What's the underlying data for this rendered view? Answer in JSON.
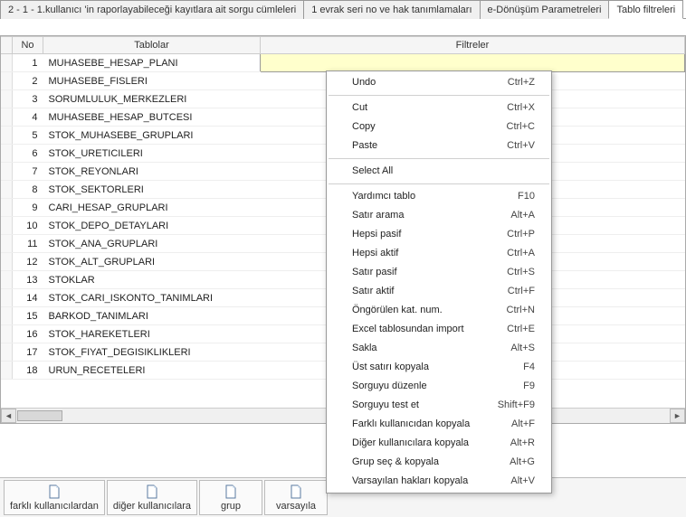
{
  "tabs": [
    {
      "label": "2 - 1 - 1.kullanıcı 'in raporlayabileceği kayıtlara ait sorgu cümleleri",
      "active": false
    },
    {
      "label": "1 evrak seri no ve hak tanımlamaları",
      "active": false
    },
    {
      "label": "e-Dönüşüm Parametreleri",
      "active": false
    },
    {
      "label": "Tablo filtreleri",
      "active": true
    }
  ],
  "grid": {
    "headers": {
      "no": "No",
      "tablolar": "Tablolar",
      "filtreler": "Filtreler"
    },
    "rows": [
      {
        "no": "1",
        "name": "MUHASEBE_HESAP_PLANI",
        "selected": true
      },
      {
        "no": "2",
        "name": "MUHASEBE_FISLERI"
      },
      {
        "no": "3",
        "name": "SORUMLULUK_MERKEZLERI"
      },
      {
        "no": "4",
        "name": "MUHASEBE_HESAP_BUTCESI"
      },
      {
        "no": "5",
        "name": "STOK_MUHASEBE_GRUPLARI"
      },
      {
        "no": "6",
        "name": "STOK_URETICILERI"
      },
      {
        "no": "7",
        "name": "STOK_REYONLARI"
      },
      {
        "no": "8",
        "name": "STOK_SEKTORLERI"
      },
      {
        "no": "9",
        "name": "CARI_HESAP_GRUPLARI"
      },
      {
        "no": "10",
        "name": "STOK_DEPO_DETAYLARI"
      },
      {
        "no": "11",
        "name": "STOK_ANA_GRUPLARI"
      },
      {
        "no": "12",
        "name": "STOK_ALT_GRUPLARI"
      },
      {
        "no": "13",
        "name": "STOKLAR"
      },
      {
        "no": "14",
        "name": "STOK_CARI_ISKONTO_TANIMLARI"
      },
      {
        "no": "15",
        "name": "BARKOD_TANIMLARI"
      },
      {
        "no": "16",
        "name": "STOK_HAREKETLERI"
      },
      {
        "no": "17",
        "name": "STOK_FIYAT_DEGISIKLIKLERI"
      },
      {
        "no": "18",
        "name": "URUN_RECETELERI"
      }
    ]
  },
  "context_menu": [
    {
      "label": "Undo",
      "shortcut": "Ctrl+Z"
    },
    {
      "sep": true
    },
    {
      "label": "Cut",
      "shortcut": "Ctrl+X"
    },
    {
      "label": "Copy",
      "shortcut": "Ctrl+C"
    },
    {
      "label": "Paste",
      "shortcut": "Ctrl+V"
    },
    {
      "sep": true
    },
    {
      "label": "Select All"
    },
    {
      "sep": true
    },
    {
      "label": "Yardımcı tablo",
      "shortcut": "F10"
    },
    {
      "label": "Satır arama",
      "shortcut": "Alt+A"
    },
    {
      "label": "Hepsi pasif",
      "shortcut": "Ctrl+P"
    },
    {
      "label": "Hepsi aktif",
      "shortcut": "Ctrl+A"
    },
    {
      "label": "Satır pasif",
      "shortcut": "Ctrl+S"
    },
    {
      "label": "Satır aktif",
      "shortcut": "Ctrl+F"
    },
    {
      "label": "Öngörülen kat. num.",
      "shortcut": "Ctrl+N"
    },
    {
      "label": "Excel tablosundan import",
      "shortcut": "Ctrl+E"
    },
    {
      "label": "Sakla",
      "shortcut": "Alt+S"
    },
    {
      "label": "Üst satırı kopyala",
      "shortcut": "F4"
    },
    {
      "label": "Sorguyu düzenle",
      "shortcut": "F9"
    },
    {
      "label": "Sorguyu test et",
      "shortcut": "Shift+F9"
    },
    {
      "label": "Farklı kullanıcıdan kopyala",
      "shortcut": "Alt+F"
    },
    {
      "label": "Diğer kullanıcılara kopyala",
      "shortcut": "Alt+R"
    },
    {
      "label": "Grup seç & kopyala",
      "shortcut": "Alt+G"
    },
    {
      "label": "Varsayılan hakları kopyala",
      "shortcut": "Alt+V"
    }
  ],
  "toolbar": [
    {
      "label": "farklı kullanıcılardan"
    },
    {
      "label": "diğer kullanıcılara"
    },
    {
      "label": "grup"
    },
    {
      "label": "varsayıla"
    }
  ]
}
